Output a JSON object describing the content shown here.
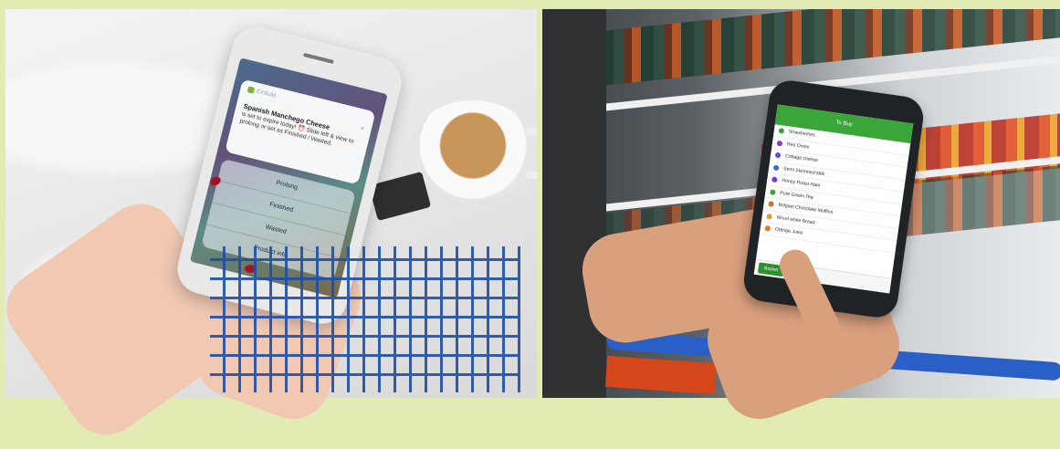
{
  "left_photo": {
    "notification": {
      "app_name": "EXSUM",
      "title": "Spanish Manchego Cheese",
      "body": "is set to expire today! ⏰ Slide left & view to prolong or set as Finished / Wasted.",
      "close_glyph": "×"
    },
    "actions": [
      "Prolong",
      "Finished",
      "Wasted",
      "Product info"
    ]
  },
  "right_photo": {
    "app_bar_title": "To Buy",
    "list_items": [
      {
        "label": "Strawberries",
        "color": "#3aa63a"
      },
      {
        "label": "Red Onion",
        "color": "#8a3ad0"
      },
      {
        "label": "Cottage cheese",
        "color": "#6a4bd8"
      },
      {
        "label": "Semi Skimmed Milk",
        "color": "#3a6ad0"
      },
      {
        "label": "Honey Roast Ham",
        "color": "#7a3ad0"
      },
      {
        "label": "Pure Green Tea",
        "color": "#3aa63a"
      },
      {
        "label": "Belgian Chocolate Muffins",
        "color": "#c07a2a"
      },
      {
        "label": "Wood white Bread",
        "color": "#d0a23a"
      },
      {
        "label": "Orange Juice",
        "color": "#e27a1a"
      }
    ],
    "tab_active": "Basket"
  },
  "colors": {
    "border": "#e3ebb4",
    "app_green": "#3aa63a",
    "nail_polish": "#a0142a"
  }
}
